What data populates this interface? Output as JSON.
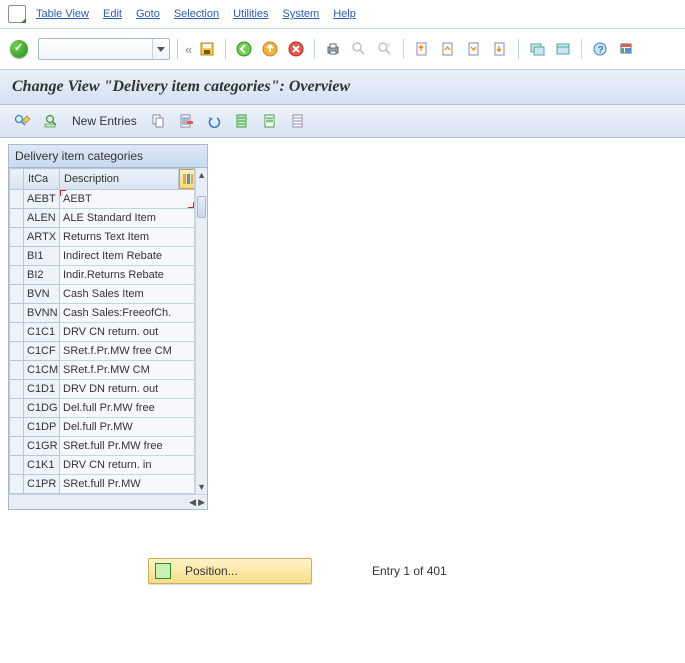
{
  "menubar": {
    "items": [
      "Table View",
      "Edit",
      "Goto",
      "Selection",
      "Utilities",
      "System",
      "Help"
    ]
  },
  "toolbar": {
    "combo_value": "",
    "buttons": [
      "prev-chevrons",
      "save",
      "sep",
      "go-back",
      "go-exit",
      "go-cancel",
      "sep",
      "print",
      "find",
      "find-next",
      "sep",
      "first-page",
      "prev-page",
      "next-page",
      "last-page",
      "sep",
      "new-session",
      "layout",
      "sep",
      "help",
      "gui-settings"
    ]
  },
  "title": "Change View \"Delivery item categories\": Overview",
  "apptoolbar": {
    "new_entries_label": "New Entries",
    "buttons": [
      "display-change",
      "find",
      "new-entries",
      "copy",
      "delete",
      "undo",
      "select-all",
      "select-block",
      "deselect-all"
    ]
  },
  "table": {
    "title": "Delivery item categories",
    "columns": [
      "ItCa",
      "Description"
    ],
    "rows": [
      {
        "code": "AEBT",
        "desc": "AEBT"
      },
      {
        "code": "ALEN",
        "desc": "ALE Standard Item"
      },
      {
        "code": "ARTX",
        "desc": "Returns Text Item"
      },
      {
        "code": "BI1",
        "desc": "Indirect Item Rebate"
      },
      {
        "code": "BI2",
        "desc": "Indir.Returns Rebate"
      },
      {
        "code": "BVN",
        "desc": "Cash Sales Item"
      },
      {
        "code": "BVNN",
        "desc": "Cash Sales:FreeofCh."
      },
      {
        "code": "C1C1",
        "desc": "DRV CN return. out"
      },
      {
        "code": "C1CF",
        "desc": "SRet.f.Pr.MW free CM"
      },
      {
        "code": "C1CM",
        "desc": "SRet.f.Pr.MW CM"
      },
      {
        "code": "C1D1",
        "desc": "DRV DN return. out"
      },
      {
        "code": "C1DG",
        "desc": "Del.full Pr.MW free"
      },
      {
        "code": "C1DP",
        "desc": "Del.full Pr.MW"
      },
      {
        "code": "C1GR",
        "desc": "SRet.full Pr.MW free"
      },
      {
        "code": "C1K1",
        "desc": "DRV CN return. in"
      },
      {
        "code": "C1PR",
        "desc": "SRet.full Pr.MW"
      }
    ]
  },
  "footer": {
    "position_label": "Position...",
    "entry_text": "Entry 1 of 401"
  }
}
